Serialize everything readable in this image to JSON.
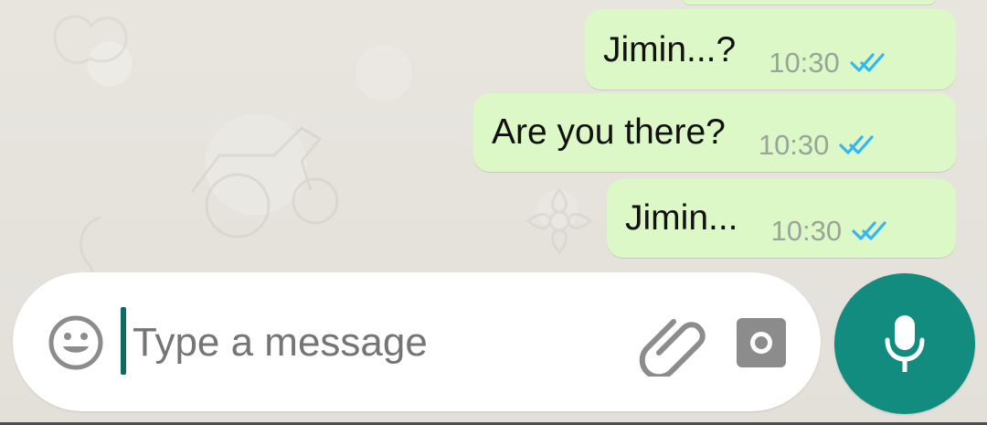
{
  "conversation": {
    "messages": [
      {
        "text": "Jimin...?",
        "time": "10:30",
        "status": "read"
      },
      {
        "text": "Are you there?",
        "time": "10:30",
        "status": "read"
      },
      {
        "text": "Jimin...",
        "time": "10:30",
        "status": "read"
      }
    ]
  },
  "composer": {
    "placeholder": "Type a message",
    "icons": {
      "emoji": "emoji-icon",
      "attach": "paperclip-icon",
      "camera": "camera-icon",
      "voice": "microphone-icon"
    }
  },
  "colors": {
    "outgoing_bubble": "#dcf8c6",
    "accent": "#128c7e",
    "read_tick": "#34b7f1",
    "chat_background": "#e6e3dd"
  }
}
